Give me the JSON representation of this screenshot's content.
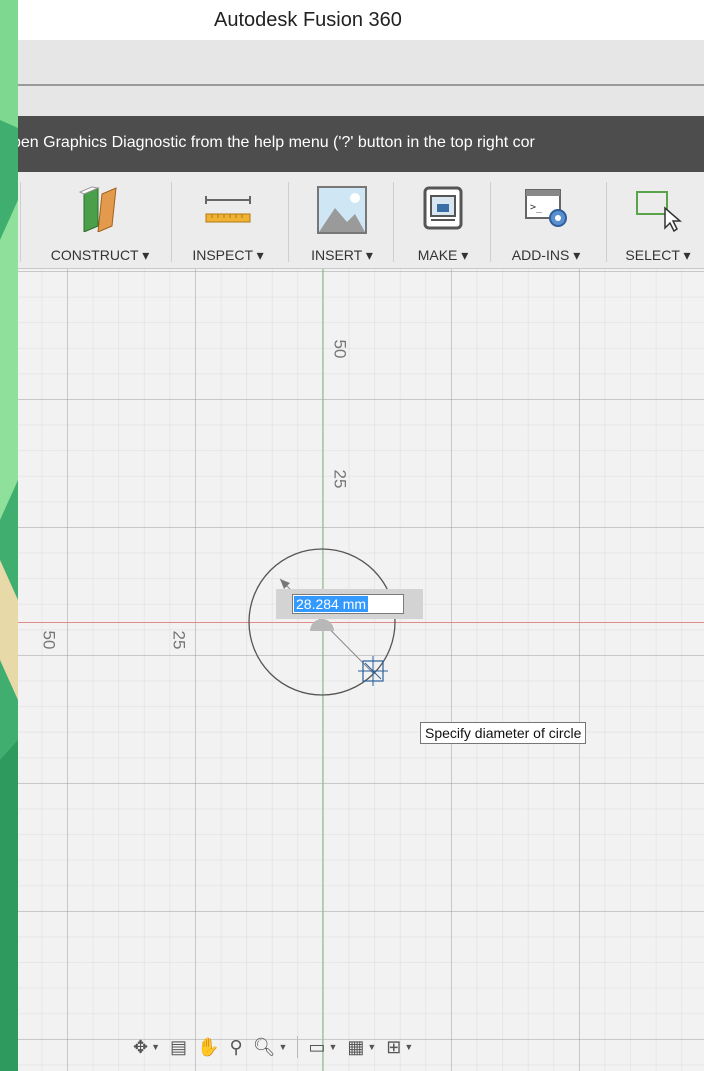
{
  "window": {
    "title": "Autodesk Fusion 360"
  },
  "notice": {
    "text": "pen Graphics Diagnostic from the help menu ('?' button in the top right cor"
  },
  "toolbar": {
    "groups": [
      {
        "label": "CONSTRUCT ▾",
        "icon": "construct-planes-icon"
      },
      {
        "label": "INSPECT ▾",
        "icon": "ruler-icon"
      },
      {
        "label": "INSERT ▾",
        "icon": "insert-image-icon"
      },
      {
        "label": "MAKE ▾",
        "icon": "3d-printer-icon"
      },
      {
        "label": "ADD-INS ▾",
        "icon": "script-gear-icon"
      },
      {
        "label": "SELECT ▾",
        "icon": "select-window-icon"
      }
    ]
  },
  "canvas": {
    "ticks": {
      "v50": "50",
      "v25": "25",
      "h50": "50",
      "h25": "25"
    },
    "dimension_value": "28.284 mm",
    "tooltip": "Specify diameter of circle"
  },
  "nav": {
    "icons": [
      "orbit-icon",
      "look-at-icon",
      "pan-hand-icon",
      "zoom-icon",
      "zoom-window-icon",
      "display-settings-icon",
      "grid-settings-icon",
      "viewports-icon"
    ]
  },
  "colors": {
    "x_axis": "#e08a8a",
    "y_axis": "#9bd59b",
    "notice_bg": "#4d4d4d",
    "selection": "#3399ff",
    "desktop": "#3fae6e"
  }
}
